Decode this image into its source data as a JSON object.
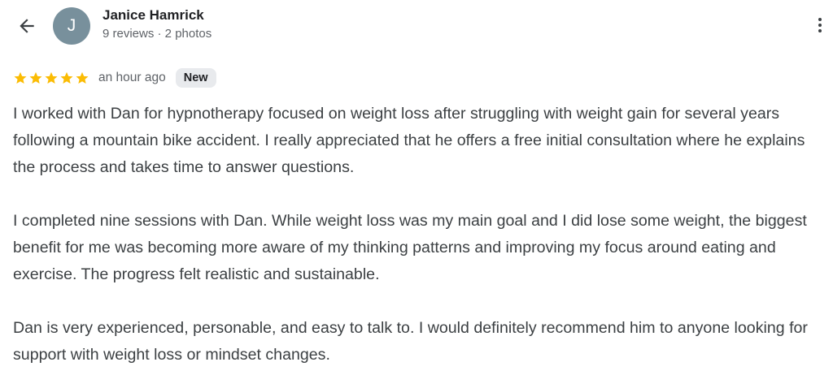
{
  "header": {
    "back_icon": "arrow-back-icon",
    "more_icon": "more-vert-icon"
  },
  "reviewer": {
    "avatar_initial": "J",
    "avatar_color": "#78909c",
    "name": "Janice Hamrick",
    "meta": "9 reviews · 2 photos"
  },
  "review": {
    "rating": 5,
    "rating_max": 5,
    "star_color": "#fbbc04",
    "time_ago": "an hour ago",
    "badge": "New",
    "paragraphs": [
      "I worked with Dan for hypnotherapy focused on weight loss after struggling with weight gain for several years following a mountain bike accident. I really appreciated that he offers a free initial consultation where he explains the process and takes time to answer questions.",
      "I completed nine sessions with Dan. While weight loss was my main goal and I did lose some weight, the biggest benefit for me was becoming more aware of my thinking patterns and improving my focus around eating and exercise. The progress felt realistic and sustainable.",
      "Dan is very experienced, personable, and easy to talk to. I would definitely recommend him to anyone looking for support with weight loss or mindset changes."
    ]
  }
}
